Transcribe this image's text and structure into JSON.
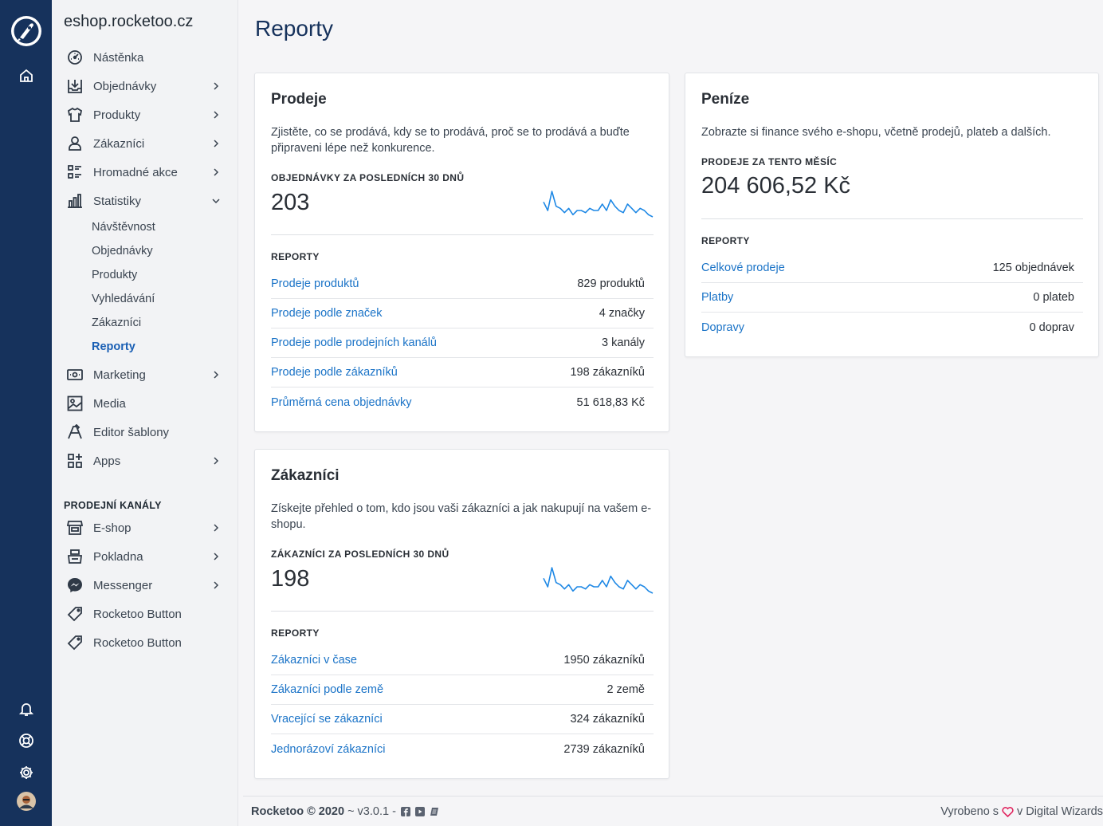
{
  "rail": {
    "icons": [
      "rocket-logo-icon",
      "home-icon",
      "bell-icon",
      "help-icon",
      "gear-icon",
      "avatar"
    ]
  },
  "sidebar": {
    "shop_name": "eshop.rocketoo.cz",
    "items": [
      {
        "label": "Nástěnka",
        "icon": "dashboard-icon",
        "chevron": false
      },
      {
        "label": "Objednávky",
        "icon": "orders-icon",
        "chevron": true
      },
      {
        "label": "Produkty",
        "icon": "shirt-icon",
        "chevron": true
      },
      {
        "label": "Zákazníci",
        "icon": "user-icon",
        "chevron": true
      },
      {
        "label": "Hromadné akce",
        "icon": "bulk-actions-icon",
        "chevron": true
      },
      {
        "label": "Statistiky",
        "icon": "chart-icon",
        "chevron": "down"
      }
    ],
    "sub_items": [
      "Návštěvnost",
      "Objednávky",
      "Produkty",
      "Vyhledávání",
      "Zákazníci",
      "Reporty"
    ],
    "active_sub": "Reporty",
    "items2": [
      {
        "label": "Marketing",
        "icon": "marketing-icon",
        "chevron": true
      },
      {
        "label": "Media",
        "icon": "image-icon",
        "chevron": false
      },
      {
        "label": "Editor šablony",
        "icon": "editor-icon",
        "chevron": false
      },
      {
        "label": "Apps",
        "icon": "apps-icon",
        "chevron": true
      }
    ],
    "section_title": "PRODEJNÍ KANÁLY",
    "channels": [
      {
        "label": "E-shop",
        "icon": "store-icon",
        "chevron": true
      },
      {
        "label": "Pokladna",
        "icon": "register-icon",
        "chevron": true
      },
      {
        "label": "Messenger",
        "icon": "messenger-icon",
        "chevron": true
      },
      {
        "label": "Rocketoo Button",
        "icon": "tag-icon",
        "chevron": false
      },
      {
        "label": "Rocketoo Button",
        "icon": "tag-icon",
        "chevron": false
      }
    ]
  },
  "main": {
    "title": "Reporty",
    "sales_card": {
      "title": "Prodeje",
      "description": "Zjistěte, co se prodává, kdy se to prodává, proč se to prodává a buďte připraveni lépe než konkurence.",
      "stat_label": "OBJEDNÁVKY ZA POSLEDNÍCH 30 DNŮ",
      "stat_value": "203",
      "sparkline": [
        9,
        5,
        14,
        7,
        6,
        4,
        6,
        3,
        5,
        5,
        4,
        6,
        5,
        5,
        8,
        5,
        10,
        7,
        5,
        4,
        8,
        6,
        4,
        6,
        5,
        3,
        2
      ],
      "reports_label": "REPORTY",
      "reports": [
        {
          "label": "Prodeje produktů",
          "value": "829 produktů"
        },
        {
          "label": "Prodeje podle značek",
          "value": "4 značky"
        },
        {
          "label": "Prodeje podle prodejních kanálů",
          "value": "3 kanály"
        },
        {
          "label": "Prodeje podle zákazníků",
          "value": "198 zákazníků"
        },
        {
          "label": "Průměrná cena objednávky",
          "value": "51 618,83 Kč"
        }
      ]
    },
    "customers_card": {
      "title": "Zákazníci",
      "description": "Získejte přehled o tom, kdo jsou vaši zákazníci a jak nakupují na vašem e-shopu.",
      "stat_label": "ZÁKAZNÍCI ZA POSLEDNÍCH 30 DNŮ",
      "stat_value": "198",
      "sparkline": [
        9,
        5,
        14,
        7,
        6,
        4,
        6,
        3,
        5,
        5,
        4,
        6,
        5,
        5,
        8,
        5,
        10,
        7,
        5,
        4,
        8,
        6,
        4,
        6,
        5,
        3,
        2
      ],
      "reports_label": "REPORTY",
      "reports": [
        {
          "label": "Zákazníci v čase",
          "value": "1950 zákazníků"
        },
        {
          "label": "Zákazníci podle země",
          "value": "2 země"
        },
        {
          "label": "Vracející se zákazníci",
          "value": "324 zákazníků"
        },
        {
          "label": "Jednorázoví zákazníci",
          "value": "2739 zákazníků"
        }
      ]
    },
    "money_card": {
      "title": "Peníze",
      "description": "Zobrazte si finance svého e-shopu, včetně prodejů, plateb a dalších.",
      "stat_label": "PRODEJE ZA TENTO MĚSÍC",
      "stat_value": "204 606,52 Kč",
      "reports_label": "REPORTY",
      "reports": [
        {
          "label": "Celkové prodeje",
          "value": "125 objednávek"
        },
        {
          "label": "Platby",
          "value": "0 plateb"
        },
        {
          "label": "Dopravy",
          "value": "0 doprav"
        }
      ]
    }
  },
  "footer": {
    "brand": "Rocketoo © 2020",
    "version": "~ v3.0.1 -",
    "made_prefix": "Vyrobeno s",
    "made_suffix": "v Digital Wizards"
  },
  "colors": {
    "rail": "#16325c",
    "link": "#1a73c7",
    "active": "#1a5fb4",
    "sparkline": "#1e88e5",
    "heart": "#e0245e"
  }
}
